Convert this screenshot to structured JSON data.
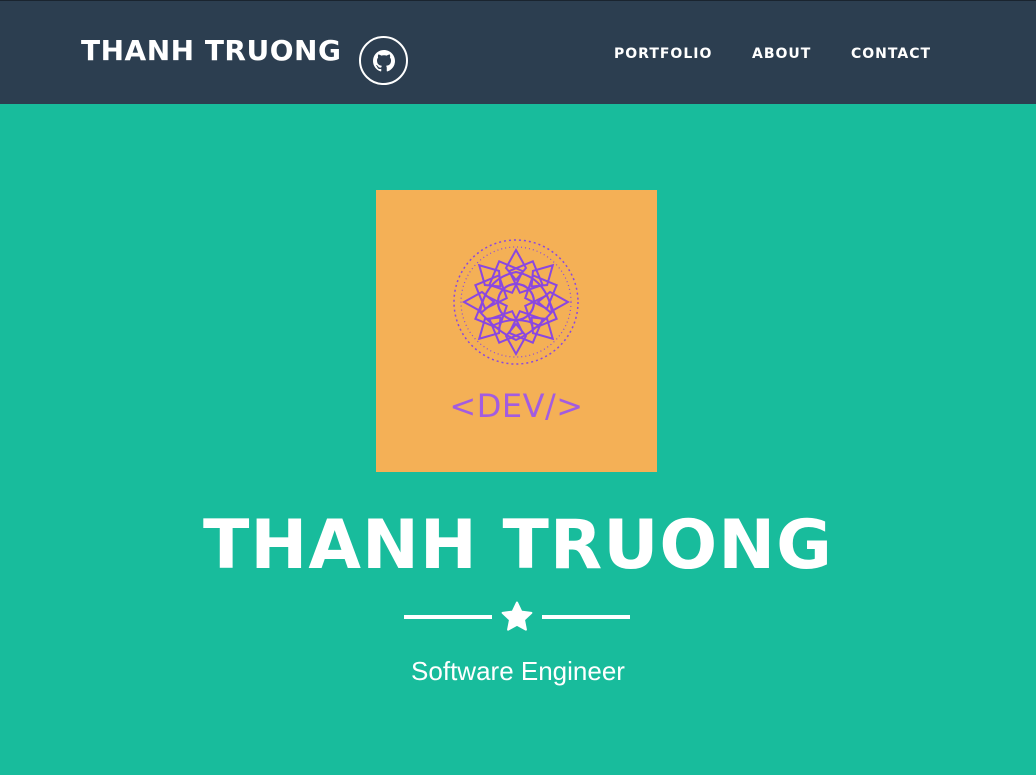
{
  "navbar": {
    "brand": "THANH TRUONG",
    "github_icon": "github-icon",
    "links": [
      "PORTFOLIO",
      "ABOUT",
      "CONTACT"
    ]
  },
  "hero": {
    "logo_label": "<DEV/>",
    "logo_icon": "mandala-icon",
    "title": "THANH TRUONG",
    "divider_icon": "star-icon",
    "subtitle": "Software Engineer"
  },
  "colors": {
    "navbar": "#2c3e50",
    "background": "#18bc9c",
    "logo_background": "#f4b056",
    "logo_accent": "#8a47e0",
    "text": "#ffffff"
  }
}
